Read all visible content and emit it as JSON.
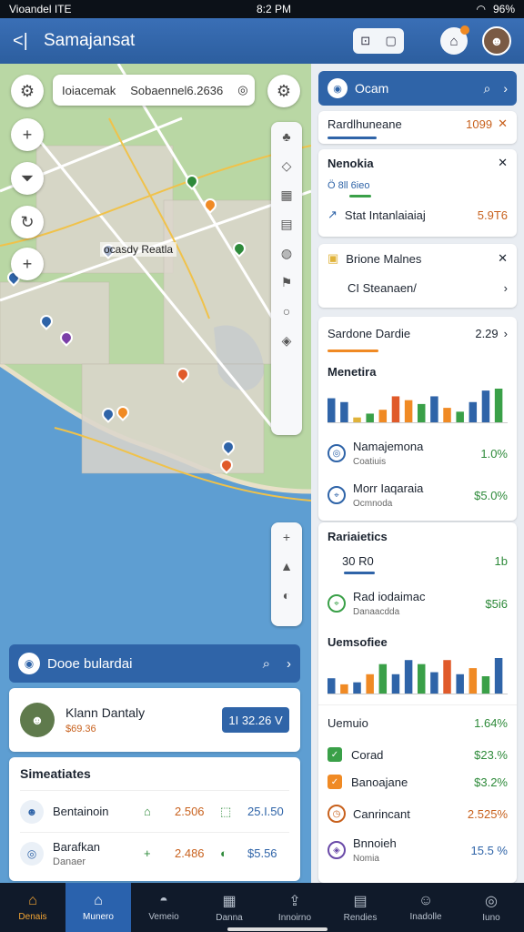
{
  "status": {
    "carrier": "Vioandel ITE",
    "time": "8:2 PM",
    "battery": "96%"
  },
  "appbar": {
    "title": "Samajansat"
  },
  "map": {
    "search_a": "Ioiacemak",
    "search_b": "Sobaennel6.2636",
    "place_label": "ocasdy Reatla"
  },
  "left_panel": {
    "header": "Dooe bulardai",
    "person": {
      "name": "Klann Dantaly",
      "sub": "$69.36",
      "value": "1I 32.26 V"
    },
    "stats_title": "Simeatiates",
    "stats": [
      {
        "name": "Bentainoin",
        "sub": "",
        "c1": "⌂",
        "c2": "2.506",
        "c3": "⬚",
        "c4": "25.I.50"
      },
      {
        "name": "Barafkan",
        "sub": "Danaer",
        "c1": "+",
        "c2": "2.486",
        "c3": "◐",
        "c4": "$5.56"
      }
    ]
  },
  "right_panel": {
    "header": "Ocam",
    "top_row": {
      "label": "Rardlhuneane",
      "value": "1099"
    },
    "card2": {
      "title": "Nenokia",
      "row1": "Ö 8ll 6ieo",
      "row2_label": "Stat Intanlaiaiaj",
      "row2_value": "5.9T6"
    },
    "card3": {
      "title": "Brione Malnes",
      "sub": "CI Steanaen/"
    },
    "summary": {
      "label": "Sardone Dardie",
      "value": "2.29"
    },
    "metrics_title": "Menetira",
    "metrics_bars": [
      {
        "v": 26,
        "c": "#2f64a8"
      },
      {
        "v": 22,
        "c": "#2f64a8"
      },
      {
        "v": 6,
        "c": "#e0b33a"
      },
      {
        "v": 10,
        "c": "#3aa048"
      },
      {
        "v": 14,
        "c": "#f08a24"
      },
      {
        "v": 28,
        "c": "#e05a2a"
      },
      {
        "v": 24,
        "c": "#f08a24"
      },
      {
        "v": 20,
        "c": "#3aa048"
      },
      {
        "v": 28,
        "c": "#2f64a8"
      },
      {
        "v": 16,
        "c": "#f08a24"
      },
      {
        "v": 12,
        "c": "#3aa048"
      },
      {
        "v": 22,
        "c": "#2f64a8"
      },
      {
        "v": 34,
        "c": "#2f64a8"
      },
      {
        "v": 36,
        "c": "#3aa048"
      }
    ],
    "metric_rows": [
      {
        "name": "Namajemona",
        "sub": "Coatiuis",
        "value": "1.0%",
        "cls": "g"
      },
      {
        "name": "Morr Iaqaraia",
        "sub": "Ocmnoda",
        "value": "$5.0%",
        "cls": "g"
      }
    ],
    "radiatics_title": "Rariaietics",
    "rad_rows": [
      {
        "name": "30 R0",
        "sub": "",
        "value": "1b",
        "cls": "g"
      },
      {
        "name": "Rad iodaimac",
        "sub": "Danaacdda",
        "value": "$5i6",
        "cls": "g"
      }
    ],
    "dem_title": "Uemsofiee",
    "dem_bars": [
      {
        "v": 16,
        "c": "#2f64a8"
      },
      {
        "v": 10,
        "c": "#f08a24"
      },
      {
        "v": 12,
        "c": "#2f64a8"
      },
      {
        "v": 20,
        "c": "#f08a24"
      },
      {
        "v": 30,
        "c": "#3aa048"
      },
      {
        "v": 20,
        "c": "#2f64a8"
      },
      {
        "v": 34,
        "c": "#2f64a8"
      },
      {
        "v": 30,
        "c": "#3aa048"
      },
      {
        "v": 22,
        "c": "#2f64a8"
      },
      {
        "v": 34,
        "c": "#e05a2a"
      },
      {
        "v": 20,
        "c": "#2f64a8"
      },
      {
        "v": 26,
        "c": "#f08a24"
      },
      {
        "v": 18,
        "c": "#3aa048"
      },
      {
        "v": 36,
        "c": "#2f64a8"
      }
    ],
    "list_title": "Uemuio",
    "list_title_value": "1.64%",
    "list": [
      {
        "name": "Corad",
        "value": "$23.%",
        "cls": "g"
      },
      {
        "name": "Banoajane",
        "value": "$3.2%",
        "cls": "g"
      },
      {
        "name": "Canrincant",
        "value": "2.525%",
        "cls": "o"
      },
      {
        "name": "Bnnoieh",
        "sub": "Nomia",
        "value": "15.5 %",
        "cls": "b"
      }
    ]
  },
  "nav": [
    {
      "label": "Denais"
    },
    {
      "label": "Munero"
    },
    {
      "label": "Vemeio"
    },
    {
      "label": "Danna"
    },
    {
      "label": "Innoirno"
    },
    {
      "label": "Rendies"
    },
    {
      "label": "Inadolle"
    },
    {
      "label": "Iuno"
    }
  ]
}
